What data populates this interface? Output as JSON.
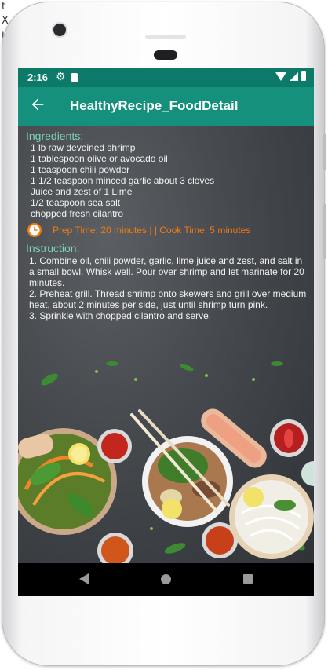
{
  "background_doc": {
    "lines": [
      "t",
      "X",
      "ıt"
    ]
  },
  "status_bar": {
    "time": "2:16"
  },
  "app_bar": {
    "title": "HealthyRecipe_FoodDetail"
  },
  "ingredients": {
    "title": "Ingredients:",
    "items": [
      "1 lb raw deveined shrimp",
      "1 tablespoon olive or avocado oil",
      "1 teaspoon chili powder",
      "1 1/2 teaspoon minced garlic about 3 cloves",
      "Juice and zest of 1 Lime",
      "1/2 teaspoon sea salt",
      "chopped fresh cilantro"
    ]
  },
  "timing": {
    "text": "Prep Time: 20 minutes | | Cook Time: 5 minutes"
  },
  "instruction": {
    "title": "Instruction:",
    "steps": [
      "1. Combine oil, chili powder, garlic, lime juice and zest, and salt in a small bowl. Whisk well. Pour over shrimp and let marinate for 20 minutes.",
      "2. Preheat grill. Thread shrimp onto skewers and grill over medium heat, about 2 minutes per side, just until shrimp turn pink.",
      "3. Sprinkle with chopped cilantro and serve."
    ]
  },
  "colors": {
    "status_bar": "#0d7a69",
    "app_bar": "#15907d",
    "section_title": "#7fd4b8",
    "prep_text": "#f07a10"
  },
  "icons": {
    "back": "arrow-left-icon",
    "clock": "clock-icon",
    "settings": "gear-icon"
  }
}
